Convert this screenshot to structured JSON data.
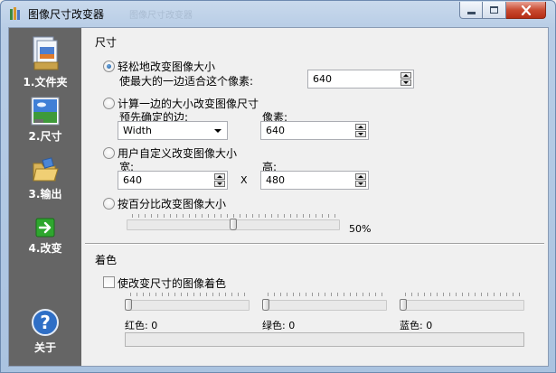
{
  "window": {
    "title": "图像尺寸改变器",
    "ghost_title": "图像尺寸改变器"
  },
  "sidebar": {
    "items": [
      {
        "label": "1.文件夹",
        "icon": "folder-documents-icon"
      },
      {
        "label": "2.尺寸",
        "icon": "landscape-picture-icon"
      },
      {
        "label": "3.输出",
        "icon": "open-folder-icon"
      },
      {
        "label": "4.改变",
        "icon": "green-arrow-icon"
      }
    ],
    "about": {
      "label": "关于",
      "icon": "help-question-icon"
    }
  },
  "size_group": {
    "title": "尺寸",
    "option_easy": {
      "label": "轻松地改变图像大小",
      "checked": true,
      "sub_label": "使最大的一边适合这个像素:",
      "value": "640"
    },
    "option_one_side": {
      "label": "计算一边的大小改变图像尺寸",
      "checked": false,
      "side_label": "预先确定的边:",
      "side_value": "Width",
      "pixels_label": "像素:",
      "pixels_value": "640"
    },
    "option_custom": {
      "label": "用户自定义改变图像大小",
      "checked": false,
      "width_label": "宽:",
      "width_value": "640",
      "times": "X",
      "height_label": "高:",
      "height_value": "480"
    },
    "option_percent": {
      "label": "按百分比改变图像大小",
      "checked": false,
      "value_label": "50%",
      "value_fraction": 0.5
    }
  },
  "color_group": {
    "title": "着色",
    "colorize_label": "使改变尺寸的图像着色",
    "colorize_checked": false,
    "red_label": "红色: 0",
    "green_label": "绿色: 0",
    "blue_label": "蓝色: 0",
    "red_value": 0,
    "green_value": 0,
    "blue_value": 0
  },
  "colors": {
    "sidebar_bg": "#656565",
    "titlebar": "#b8cde6",
    "close_button": "#c94b32"
  }
}
